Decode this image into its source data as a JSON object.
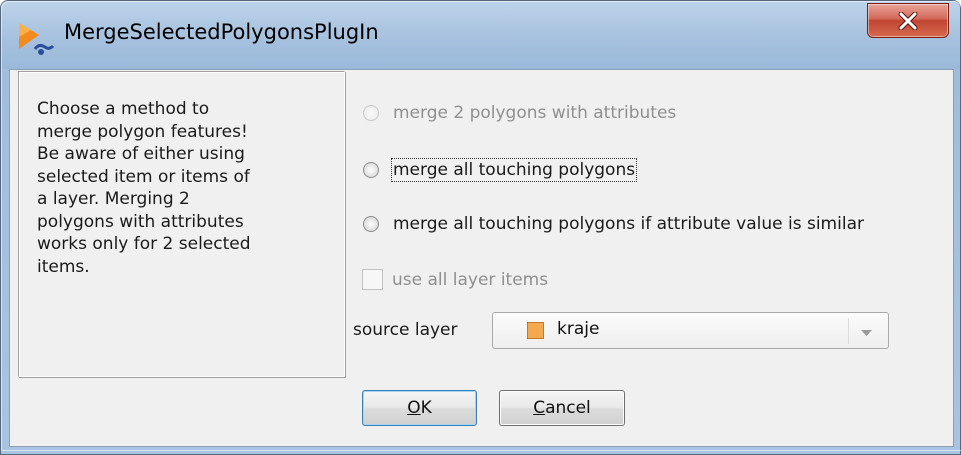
{
  "window": {
    "title": "MergeSelectedPolygonsPlugIn",
    "close_glyph": "X"
  },
  "description": "Choose a method to\nmerge polygon features!\nBe aware of either using\nselected item or items of\na layer. Merging 2\npolygons with attributes\nworks only for 2 selected\nitems.",
  "options": {
    "merge_two": {
      "label": "merge 2 polygons with attributes",
      "enabled": false,
      "selected": false
    },
    "merge_all_touching": {
      "label": "merge all touching polygons",
      "enabled": true,
      "selected": false,
      "focused": true
    },
    "merge_touching_similar": {
      "label": "merge all touching polygons if attribute value is similar",
      "enabled": true,
      "selected": false
    }
  },
  "use_all_layer_items": {
    "label": "use all layer items",
    "checked": false,
    "enabled": false
  },
  "source_layer": {
    "label": "source layer",
    "value": "kraje",
    "swatch_color": "#f5a94f"
  },
  "buttons": {
    "ok_mnemonic": "O",
    "ok_rest": "K",
    "cancel_mnemonic": "C",
    "cancel_rest": "ancel"
  },
  "icons": {
    "app": "plugin-app-icon",
    "close": "close-icon",
    "dropdown": "chevron-down-icon"
  }
}
